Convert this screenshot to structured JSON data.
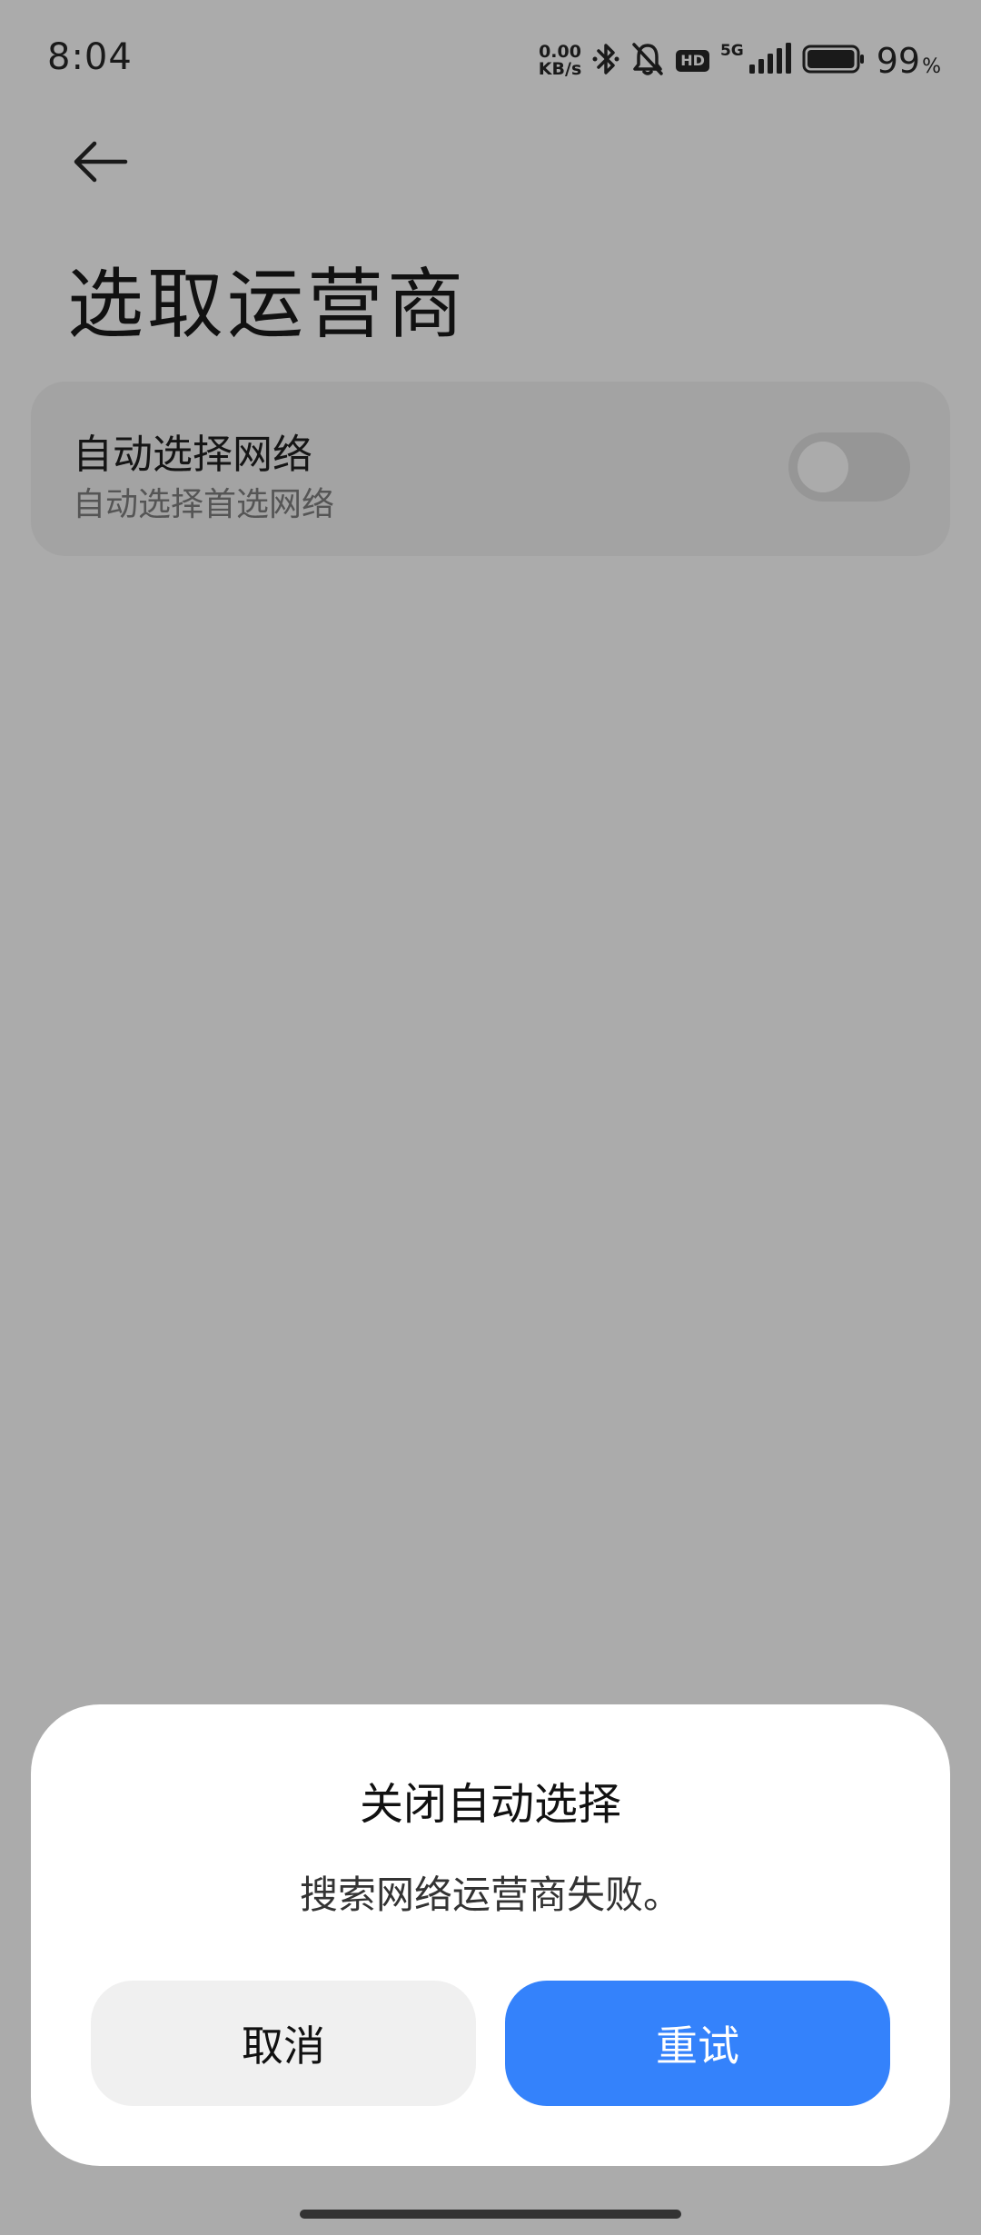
{
  "status_bar": {
    "time": "8:04",
    "net_speed_value": "0.00",
    "net_speed_unit": "KB/s",
    "hd_label": "HD",
    "network_label": "5G",
    "battery_value": "99",
    "battery_unit": "%",
    "battery_level": 99
  },
  "page": {
    "title": "选取运营商"
  },
  "auto_select": {
    "title": "自动选择网络",
    "subtitle": "自动选择首选网络",
    "enabled": false
  },
  "dialog": {
    "title": "关闭自动选择",
    "message": "搜索网络运营商失败。",
    "cancel_label": "取消",
    "retry_label": "重试"
  },
  "colors": {
    "background_dim": "#ababab",
    "dialog_bg": "#ffffff",
    "primary_button": "#3482fb",
    "secondary_button": "#f0f0f0"
  },
  "icons": {
    "back": "arrow-left-icon",
    "bluetooth": "bluetooth-icon",
    "notifications": "bell-off-icon",
    "signal": "signal-bars-icon",
    "battery": "battery-icon"
  }
}
